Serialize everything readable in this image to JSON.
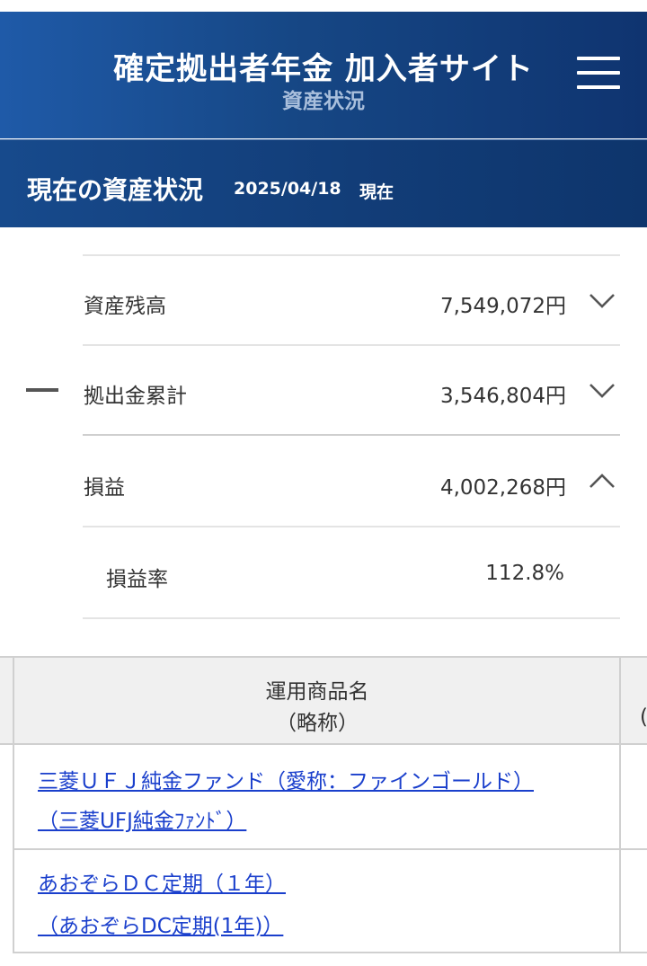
{
  "header": {
    "title": "確定拠出者年金 加入者サイト",
    "subtitle": "資産状況",
    "menu_icon": "hamburger-menu-icon"
  },
  "section": {
    "title": "現在の資産状況",
    "date": "2025/04/18",
    "suffix": "現在"
  },
  "summary": {
    "rows": [
      {
        "label": "資産残高",
        "value": "7,549,072円",
        "icon": "chevron-down-icon"
      },
      {
        "label": "拠出金累計",
        "value": "3,546,804円",
        "icon": "chevron-down-icon",
        "operator_icon": "minus-icon"
      },
      {
        "label": "損益",
        "value": "4,002,268円",
        "icon": "chevron-up-icon"
      },
      {
        "label": "損益率",
        "value": "112.8%"
      }
    ]
  },
  "table": {
    "header_line1": "運用商品名",
    "header_line2": "（略称）",
    "header_clip": "(",
    "funds": [
      {
        "name": "三菱ＵＦＪ純金ファンド（愛称：ファインゴールド）",
        "short": "（三菱UFJ純金ﾌｧﾝﾄﾞ）"
      },
      {
        "name": "あおぞらＤＣ定期（１年）",
        "short": "（あおぞらDC定期(1年)）"
      }
    ]
  }
}
